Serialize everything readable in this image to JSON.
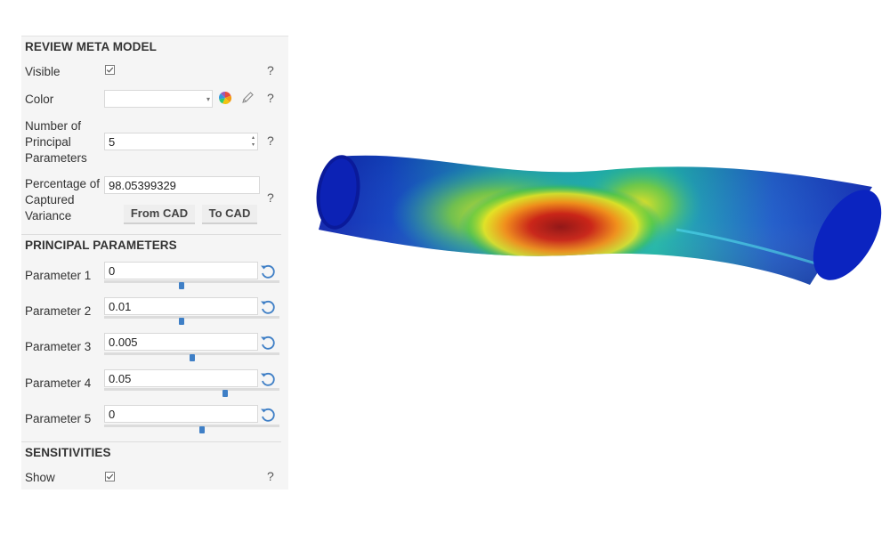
{
  "review_meta_model": {
    "title": "REVIEW META MODEL",
    "visible_label": "Visible",
    "color_label": "Color",
    "color_value": "",
    "num_params_label_1": "Number of",
    "num_params_label_2": "Principal",
    "num_params_label_3": "Parameters",
    "num_params_value": "5",
    "variance_label_1": "Percentage of",
    "variance_label_2": "Captured",
    "variance_label_3": "Variance",
    "variance_value": "98.05399329",
    "from_cad_label": "From CAD",
    "to_cad_label": "To CAD",
    "help_glyph": "?"
  },
  "principal_parameters": {
    "title": "PRINCIPAL PARAMETERS",
    "items": [
      {
        "label": "Parameter 1",
        "value": "0",
        "slider_fraction": 0.44
      },
      {
        "label": "Parameter 2",
        "value": "0.01",
        "slider_fraction": 0.44
      },
      {
        "label": "Parameter 3",
        "value": "0.005",
        "slider_fraction": 0.5
      },
      {
        "label": "Parameter 4",
        "value": "0.05",
        "slider_fraction": 0.69
      },
      {
        "label": "Parameter 5",
        "value": "0",
        "slider_fraction": 0.56
      }
    ]
  },
  "sensitivities": {
    "title": "SENSITIVITIES",
    "show_label": "Show"
  },
  "icons": {
    "checkbox": "checkbox-checked-icon",
    "color_wheel": "color-wheel-icon",
    "pencil": "pencil-icon",
    "reset": "reset-icon",
    "help": "help-icon"
  },
  "colors": {
    "accent": "#3f7fc6",
    "panel_bg": "#f5f5f5"
  }
}
